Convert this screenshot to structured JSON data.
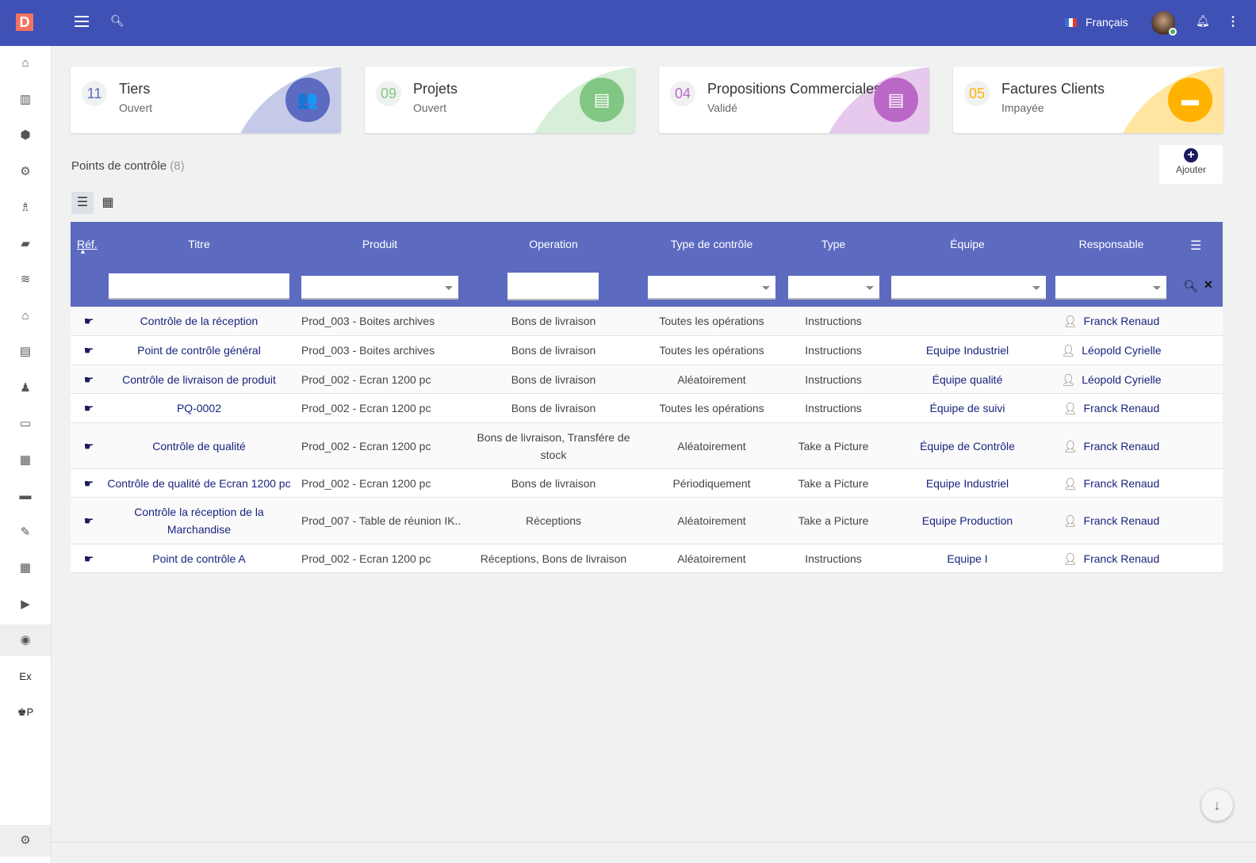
{
  "topbar": {
    "logo": "D",
    "language": "Français"
  },
  "sidebar": {
    "items": [
      "⌂",
      "▥",
      "⬢",
      "⚙",
      "♗",
      "▰",
      "≋",
      "⌂",
      "▤",
      "♟",
      "▭",
      "▦",
      "▬",
      "✎",
      "▦",
      "▶",
      "◉",
      "Ex",
      "♚P"
    ],
    "settings": "⚙"
  },
  "cards": [
    {
      "count": "11",
      "title": "Tiers",
      "subtitle": "Ouvert",
      "color": "#5c6bc0",
      "arc": "#c5cae9",
      "icon": "👥"
    },
    {
      "count": "09",
      "title": "Projets",
      "subtitle": "Ouvert",
      "color": "#81c784",
      "arc": "#d7eed8",
      "icon": "▤"
    },
    {
      "count": "04",
      "title": "Propositions Commerciales",
      "subtitle": "Validé",
      "color": "#ba68c8",
      "arc": "#e6c9ec",
      "icon": "▤"
    },
    {
      "count": "05",
      "title": "Factures Clients",
      "subtitle": "Impayée",
      "color": "#ffb300",
      "arc": "#ffe5a0",
      "icon": "▬"
    }
  ],
  "section": {
    "title": "Points de contrôle",
    "count": "(8)",
    "add_label": "Ajouter"
  },
  "columns": [
    "Réf.",
    "Titre",
    "Produit",
    "Operation",
    "Type de contrôle",
    "Type",
    "Équipe",
    "Responsable"
  ],
  "rows": [
    {
      "titre": "Contrôle de la réception",
      "produit": "Prod_003 - Boites archives",
      "operation": "Bons de livraison",
      "type_controle": "Toutes les opérations",
      "type": "Instructions",
      "equipe": "",
      "responsable": "Franck Renaud"
    },
    {
      "titre": "Point de contrôle général",
      "produit": "Prod_003 - Boites archives",
      "operation": "Bons de livraison",
      "type_controle": "Toutes les opérations",
      "type": "Instructions",
      "equipe": "Equipe Industriel",
      "responsable": "Léopold Cyrielle"
    },
    {
      "titre": "Contrôle de livraison de produit",
      "produit": "Prod_002 - Ecran 1200 pc",
      "operation": "Bons de livraison",
      "type_controle": "Aléatoirement",
      "type": "Instructions",
      "equipe": "Équipe qualité",
      "responsable": "Léopold Cyrielle"
    },
    {
      "titre": "PQ-0002",
      "produit": "Prod_002 - Ecran 1200 pc",
      "operation": "Bons de livraison",
      "type_controle": "Toutes les opérations",
      "type": "Instructions",
      "equipe": "Équipe de suivi",
      "responsable": "Franck Renaud"
    },
    {
      "titre": "Contrôle de qualité",
      "produit": "Prod_002 - Ecran 1200 pc",
      "operation": "Bons de livraison, Transfére de stock",
      "type_controle": "Aléatoirement",
      "type": "Take a Picture",
      "equipe": "Équipe de Contrôle",
      "responsable": "Franck Renaud"
    },
    {
      "titre": "Contrôle de qualité de Ecran 1200 pc",
      "produit": "Prod_002 - Ecran 1200 pc",
      "operation": "Bons de livraison",
      "type_controle": "Périodiquement",
      "type": "Take a Picture",
      "equipe": "Equipe Industriel",
      "responsable": "Franck Renaud"
    },
    {
      "titre": "Contrôle la réception de la Marchandise",
      "produit": "Prod_007 - Table de réunion IK...",
      "operation": "Réceptions",
      "type_controle": "Aléatoirement",
      "type": "Take a Picture",
      "equipe": "Equipe Production",
      "responsable": "Franck Renaud"
    },
    {
      "titre": "Point de contrôle A",
      "produit": "Prod_002 - Ecran 1200 pc",
      "operation": "Réceptions, Bons de livraison",
      "type_controle": "Aléatoirement",
      "type": "Instructions",
      "equipe": "Equipe I",
      "responsable": "Franck Renaud"
    }
  ]
}
